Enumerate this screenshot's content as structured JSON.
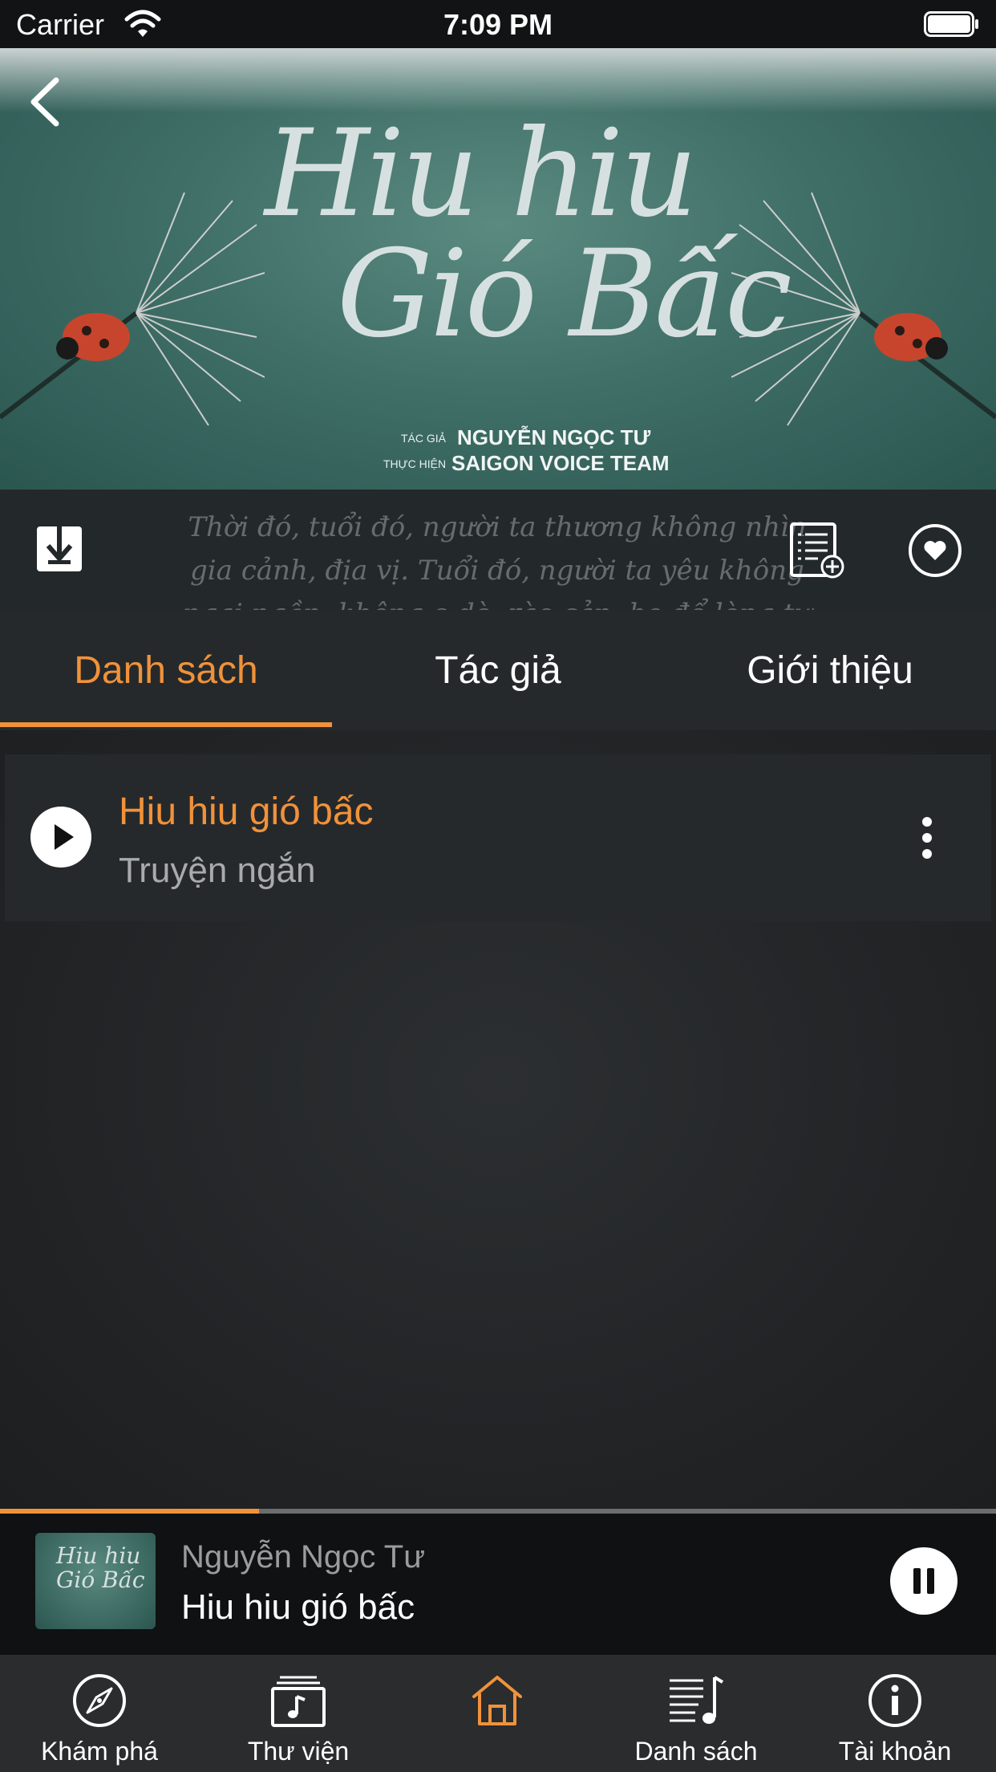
{
  "status_bar": {
    "carrier": "Carrier",
    "time": "7:09 PM"
  },
  "cover": {
    "title_line_1": "Hiu hiu",
    "title_line_2": "Gió Bấc",
    "author_label": "TÁC GIẢ",
    "author": "NGUYỄN NGỌC TƯ",
    "producer_label": "THỰC HIỆN",
    "producer": "SAIGON VOICE TEAM",
    "quote": "Thời đó, tuổi đó, người ta thương không nhìn gia cảnh, địa vị. Tuổi đó, người ta yêu không ngại ngần, không e dè, rào cản, họ để lòng tự nhiên như dòng chảy của sông."
  },
  "tabs": [
    {
      "label": "Danh sách",
      "active": true
    },
    {
      "label": "Tác giả",
      "active": false
    },
    {
      "label": "Giới thiệu",
      "active": false
    }
  ],
  "tracks": [
    {
      "title": "Hiu hiu gió bấc",
      "subtitle": "Truyện ngắn"
    }
  ],
  "now_playing": {
    "artist": "Nguyễn Ngọc Tư",
    "title": "Hiu hiu gió bấc",
    "cover_text": "Hiu hiu Gió Bấc",
    "progress": 0.26
  },
  "tab_bar": [
    {
      "label": "Khám phá",
      "icon": "compass-icon"
    },
    {
      "label": "Thư viện",
      "icon": "music-library-icon"
    },
    {
      "label": "",
      "icon": "home-icon",
      "active": true
    },
    {
      "label": "Danh sách",
      "icon": "playlist-icon"
    },
    {
      "label": "Tài khoản",
      "icon": "info-icon"
    }
  ],
  "colors": {
    "accent": "#f0923a",
    "background": "#1b1c1d",
    "tab_bar": "#2a2c2e"
  }
}
